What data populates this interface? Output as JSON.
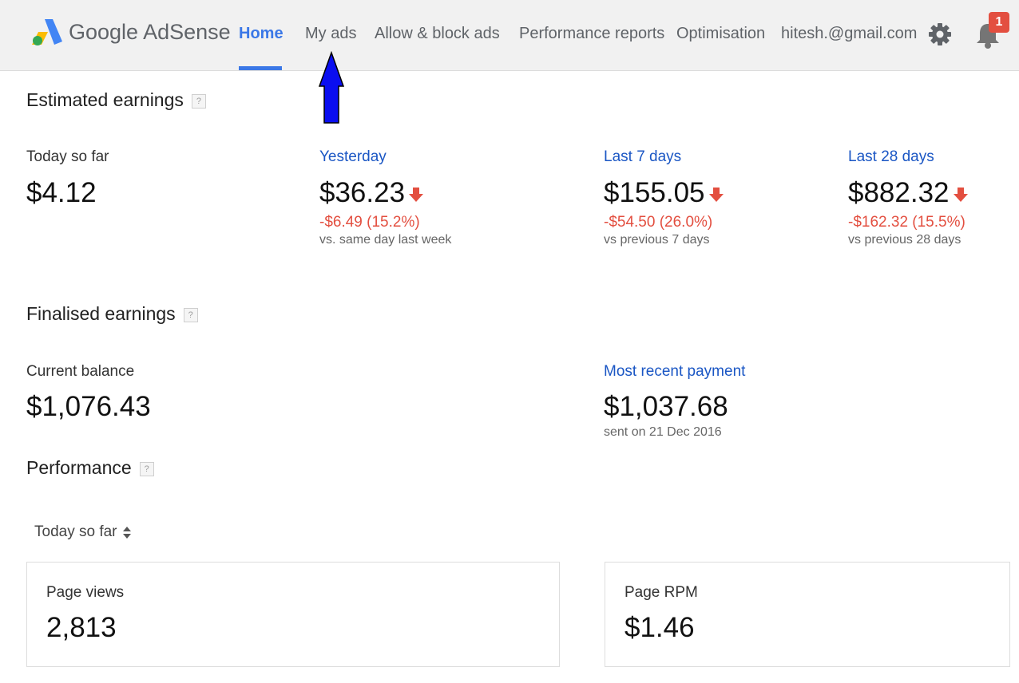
{
  "header": {
    "brand": "Google AdSense",
    "nav": [
      {
        "label": "Home",
        "active": true
      },
      {
        "label": "My ads"
      },
      {
        "label": "Allow & block ads"
      },
      {
        "label": "Performance reports"
      },
      {
        "label": "Optimisation"
      }
    ],
    "account": "hitesh.@gmail.com",
    "notification_count": "1",
    "icons": [
      "adsense-logo-icon",
      "gear-icon",
      "bell-icon"
    ],
    "accent_color": "#3b78e7"
  },
  "estimated": {
    "title": "Estimated earnings",
    "help": "?",
    "today": {
      "label": "Today so far",
      "value": "$4.12"
    },
    "yesterday": {
      "label": "Yesterday",
      "value": "$36.23",
      "change": "-$6.49 (15.2%)",
      "note": "vs. same day last week"
    },
    "last7": {
      "label": "Last 7 days",
      "value": "$155.05",
      "change": "-$54.50 (26.0%)",
      "note": "vs previous 7 days"
    },
    "last28": {
      "label": "Last 28 days",
      "value": "$882.32",
      "change": "-$162.32 (15.5%)",
      "note": "vs previous 28 days"
    },
    "decrease_color": "#e34f40"
  },
  "finalised": {
    "title": "Finalised earnings",
    "help": "?",
    "balance": {
      "label": "Current balance",
      "value": "$1,076.43"
    },
    "payment": {
      "label": "Most recent payment",
      "value": "$1,037.68",
      "note": "sent on 21 Dec 2016"
    }
  },
  "performance": {
    "title": "Performance",
    "help": "?",
    "range": "Today so far",
    "cards": [
      {
        "label": "Page views",
        "value": "2,813"
      },
      {
        "label": "Page RPM",
        "value": "$1.46"
      }
    ]
  }
}
